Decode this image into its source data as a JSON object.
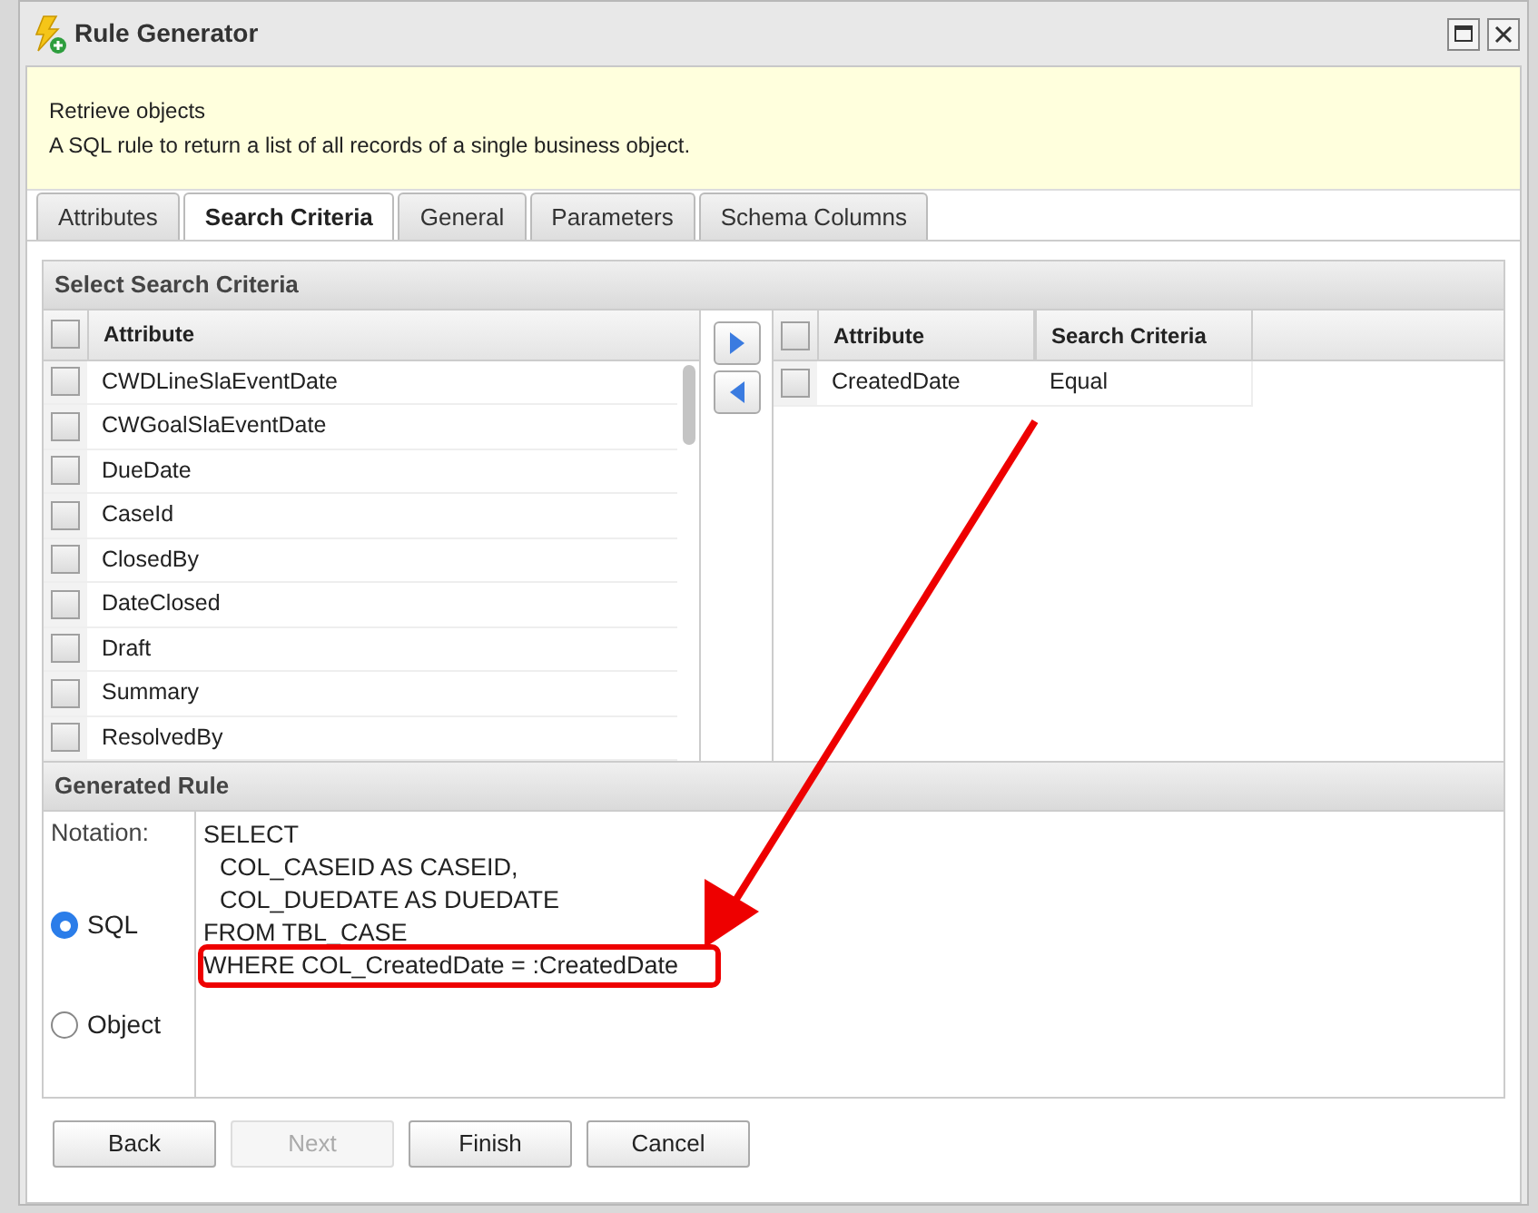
{
  "window": {
    "title": "Rule Generator"
  },
  "banner": {
    "heading": "Retrieve objects",
    "description": "A SQL rule to return a list of all records of a single business object."
  },
  "tabs": [
    {
      "label": "Attributes",
      "selected": false
    },
    {
      "label": "Search Criteria",
      "selected": true
    },
    {
      "label": "General",
      "selected": false
    },
    {
      "label": "Parameters",
      "selected": false
    },
    {
      "label": "Schema Columns",
      "selected": false
    }
  ],
  "search_criteria": {
    "title": "Select Search Criteria",
    "available": {
      "columns": [
        "Attribute"
      ],
      "all_checked": false,
      "rows": [
        {
          "attribute": "CWDLineSlaEventDate",
          "checked": false
        },
        {
          "attribute": "CWGoalSlaEventDate",
          "checked": false
        },
        {
          "attribute": "DueDate",
          "checked": false
        },
        {
          "attribute": "CaseId",
          "checked": false
        },
        {
          "attribute": "ClosedBy",
          "checked": false
        },
        {
          "attribute": "DateClosed",
          "checked": false
        },
        {
          "attribute": "Draft",
          "checked": false
        },
        {
          "attribute": "Summary",
          "checked": false
        },
        {
          "attribute": "ResolvedBy",
          "checked": false
        }
      ]
    },
    "selected": {
      "columns": [
        "Attribute",
        "Search Criteria"
      ],
      "all_checked": false,
      "rows": [
        {
          "attribute": "CreatedDate",
          "criteria": "Equal",
          "checked": false
        }
      ]
    }
  },
  "generated_rule": {
    "title": "Generated Rule",
    "notation_label": "Notation:",
    "notations": [
      {
        "label": "SQL",
        "selected": true
      },
      {
        "label": "Object",
        "selected": false
      }
    ],
    "lines": [
      {
        "text": "SELECT",
        "indent": false,
        "highlighted": false
      },
      {
        "text": "COL_CASEID AS CASEID,",
        "indent": true,
        "highlighted": false
      },
      {
        "text": "COL_DUEDATE AS DUEDATE",
        "indent": true,
        "highlighted": false
      },
      {
        "text": "FROM TBL_CASE",
        "indent": false,
        "highlighted": false
      },
      {
        "text": "WHERE COL_CreatedDate = :CreatedDate",
        "indent": false,
        "highlighted": true
      }
    ]
  },
  "buttons": [
    {
      "label": "Back",
      "disabled": false
    },
    {
      "label": "Next",
      "disabled": true
    },
    {
      "label": "Finish",
      "disabled": false
    },
    {
      "label": "Cancel",
      "disabled": false
    }
  ]
}
